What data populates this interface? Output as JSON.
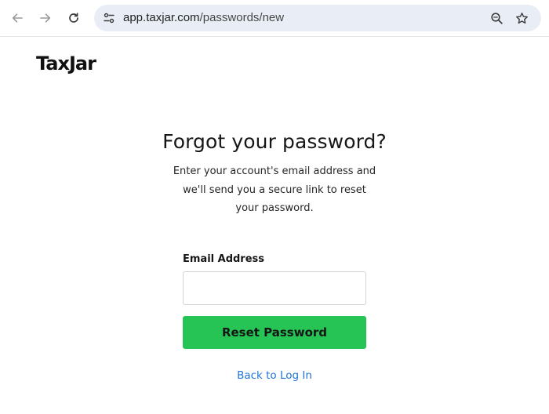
{
  "browser": {
    "url_host": "app.taxjar.com",
    "url_path": "/passwords/new",
    "icons": {
      "back": "arrow-left-icon",
      "forward": "arrow-right-icon",
      "reload": "reload-icon",
      "site_info": "tune-icon",
      "zoom": "zoom-icon",
      "bookmark": "star-icon"
    }
  },
  "page": {
    "logo": "TaxJar",
    "title": "Forgot your password?",
    "subtitle": "Enter your account's email address and we'll send you a secure link to reset your password.",
    "email_label": "Email Address",
    "email_value": "",
    "email_placeholder": "",
    "reset_button": "Reset Password",
    "back_link": "Back to Log In"
  },
  "colors": {
    "accent_green": "#25c454",
    "link_blue": "#1f74d6",
    "omnibox_bg": "#e9eef6"
  }
}
